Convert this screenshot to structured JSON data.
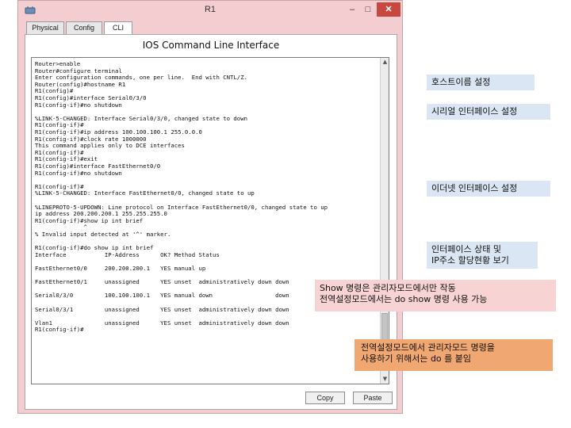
{
  "window": {
    "title": "R1",
    "minimize": "–",
    "maximize": "□",
    "close": "✕"
  },
  "tabs": [
    "Physical",
    "Config",
    "CLI"
  ],
  "panel_title": "IOS Command Line Interface",
  "terminal_lines": [
    "Router>enable",
    "Router#configure terminal",
    "Enter configuration commands, one per line.  End with CNTL/Z.",
    "Router(config)#hostname R1",
    "R1(config)#",
    "R1(config)#interface Serial0/3/0",
    "R1(config-if)#no shutdown",
    "",
    "%LINK-5-CHANGED: Interface Serial0/3/0, changed state to down",
    "R1(config-if)#",
    "R1(config-if)#ip address 100.100.100.1 255.0.0.0",
    "R1(config-if)#clock rate 1000000",
    "This command applies only to DCE interfaces",
    "R1(config-if)#",
    "R1(config-if)#exit",
    "R1(config)#interface FastEthernet0/0",
    "R1(config-if)#no shutdown",
    "",
    "R1(config-if)#",
    "%LINK-5-CHANGED: Interface FastEthernet0/0, changed state to up",
    "",
    "%LINEPROTO-5-UPDOWN: Line protocol on Interface FastEthernet0/0, changed state to up",
    "ip address 200.200.200.1 255.255.255.0",
    "R1(config-if)#show ip int brief",
    "              ^",
    "% Invalid input detected at '^' marker.",
    "",
    "R1(config-if)#do show ip int brief",
    "Interface           IP-Address      OK? Method Status",
    "",
    "FastEthernet0/0     200.200.200.1   YES manual up",
    "",
    "FastEthernet0/1     unassigned      YES unset  administratively down down",
    "",
    "Serial0/3/0         100.100.100.1   YES manual down                  down",
    "",
    "Serial0/3/1         unassigned      YES unset  administratively down down",
    "",
    "Vlan1               unassigned      YES unset  administratively down down",
    "R1(config-if)#"
  ],
  "buttons": {
    "copy": "Copy",
    "paste": "Paste"
  },
  "annotations": {
    "hostname": "호스트이름 설정",
    "serial": "시리얼 인터페이스 설정",
    "ethernet": "이더넷 인터페이스 설정",
    "status_lines": [
      "인터페이스 상태 및",
      "IP주소 할당현황 보기"
    ],
    "show_lines": [
      "Show 명령은 관리자모드에서만 작동",
      "전역설정모드에서는 do show 명령 사용 가능"
    ],
    "do_lines": [
      "전역설정모드에서 관리자모드 명령을",
      "사용하기 위해서는 do 를 붙임"
    ]
  },
  "colors": {
    "window_frame": "#f3cdd0",
    "close_button": "#c8483f",
    "note_blue": "#dbe6f4",
    "note_pink": "#f7d3d3",
    "note_orange": "#f0a772"
  }
}
